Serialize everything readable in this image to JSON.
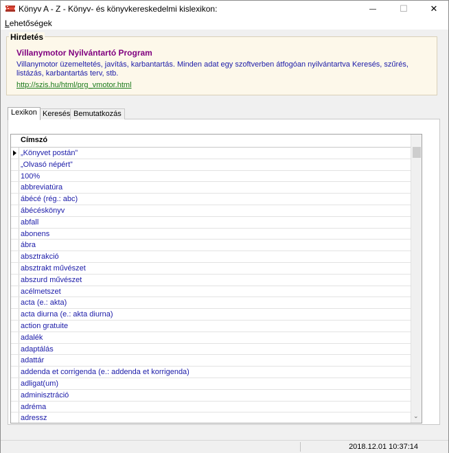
{
  "window": {
    "title": "Könyv A - Z - Könyv- és könyvkereskedelmi kislexikon:",
    "minimize_glyph": "—",
    "maximize_glyph": "☐",
    "close_glyph": "✕"
  },
  "menu": {
    "items": [
      {
        "underline": "L",
        "rest": "ehetőségek"
      }
    ]
  },
  "ad": {
    "legend": "Hirdetés",
    "title": "Villanymotor Nyilvántartó Program",
    "description": "Villanymotor üzemeltetés, javítás, karbantartás. Minden adat egy szoftverben átfogóan nyilvántartva Keresés, szűrés, listázás, karbantartás terv, stb.",
    "link": "http://szis.hu/html/prg_vmotor.html"
  },
  "tabs": [
    "Lexikon",
    "Keresés",
    "Bemutatkozás"
  ],
  "grid": {
    "column_header": "Címszó",
    "rows": [
      "„Könyvet postán”",
      "„Olvasó népért”",
      "100%",
      "abbreviatúra",
      "ábécé (rég.: abc)",
      "ábécéskönyv",
      "abfall",
      "abonens",
      "ábra",
      "absztrakció",
      "absztrakt művészet",
      "abszurd művészet",
      "acélmetszet",
      "acta (e.: akta)",
      "acta diurna (e.: akta diurna)",
      "action gratuite",
      "adalék",
      "adaptálás",
      "adattár",
      "addenda et corrigenda (e.: addenda et korrigenda)",
      "adligat(um)",
      "adminisztráció",
      "adréma",
      "adressz"
    ]
  },
  "status": {
    "datetime": "2018.12.01 10:37:14"
  },
  "colors": {
    "ad_title": "#800080",
    "link": "#1a7a1a",
    "entry_text": "#1a1aa8"
  }
}
